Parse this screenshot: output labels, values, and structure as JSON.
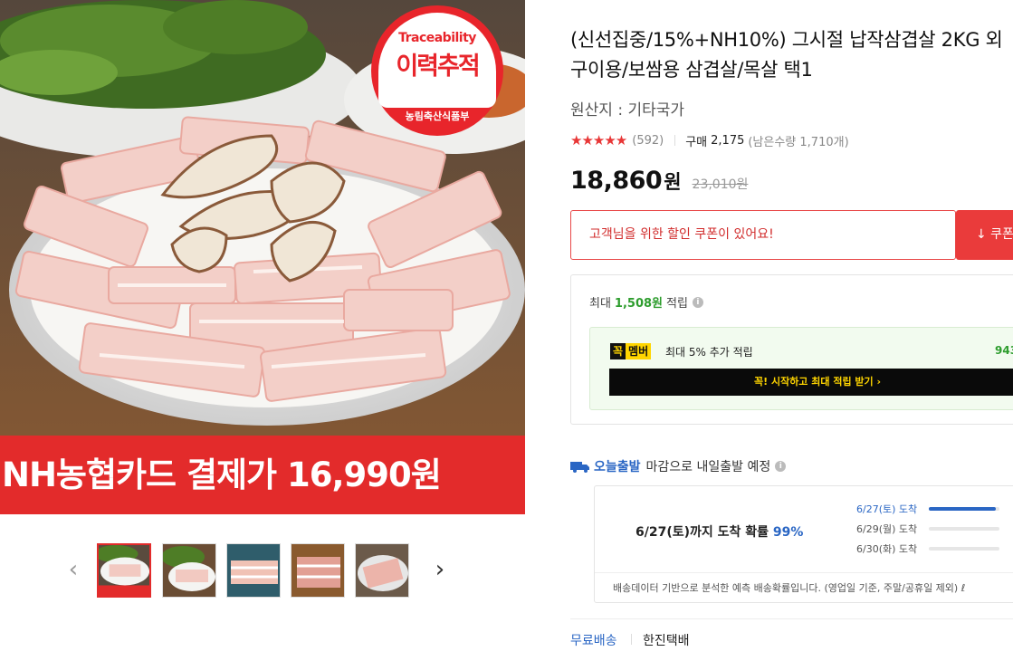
{
  "hero": {
    "badge_en": "Traceability",
    "badge_ko": "이력추적",
    "badge_sub": "농림축산식품부",
    "banner": "NH농협카드 결제가 16,990원"
  },
  "thumbnails": {
    "prev_icon": "chevron-left-icon",
    "next_icon": "chevron-right-icon",
    "count": 5,
    "active_index": 0
  },
  "product": {
    "title": "(신선집중/15%+NH10%) 그시절 납작삼겹살 2KG 외 구이용/보쌈용 삼겹살/목살 택1",
    "origin": "원산지 : 기타국가",
    "rating": 4.5,
    "stars": "★★★★★",
    "review_count": "(592)",
    "buy_label": "구매",
    "buy_count": "2,175",
    "stock": "(남은수량 1,710개)",
    "price": "18,860",
    "currency": "원",
    "original_price": "23,010원"
  },
  "coupon": {
    "message": "고객님을 위한 할인 쿠폰이 있어요!",
    "button": "↓ 쿠폰"
  },
  "points": {
    "prefix": "최대",
    "amount": "1,508원",
    "suffix": "적립",
    "member_logo_a": "꼭",
    "member_logo_b": "멤버",
    "member_text": "최대 5% 추가 적립",
    "member_amount": "943",
    "member_button": "꼭! 시작하고 최대 적립 받기 ›"
  },
  "shipping": {
    "today_label": "오늘출발",
    "today_note": "마감으로 내일출발 예정",
    "arrive_text": "6/27(토)까지 도착 확률",
    "arrive_pct": "99%",
    "dates": [
      {
        "label": "6/27(토) 도착",
        "fill": 0.95,
        "color": "#2a66c4"
      },
      {
        "label": "6/29(월) 도착",
        "fill": 0.0,
        "color": "#555555"
      },
      {
        "label": "6/30(화) 도착",
        "fill": 0.0,
        "color": "#555555"
      }
    ],
    "footer": "배송데이터 기반으로 분석한 예측 배송확률입니다. (영업일 기준, 주말/공휴일 제외) ℓ",
    "free_shipping": "무료배송",
    "courier": "한진택배"
  },
  "colors": {
    "accent_red": "#e32b2b",
    "accent_blue": "#2a66c4",
    "point_green": "#2e9d2e"
  }
}
